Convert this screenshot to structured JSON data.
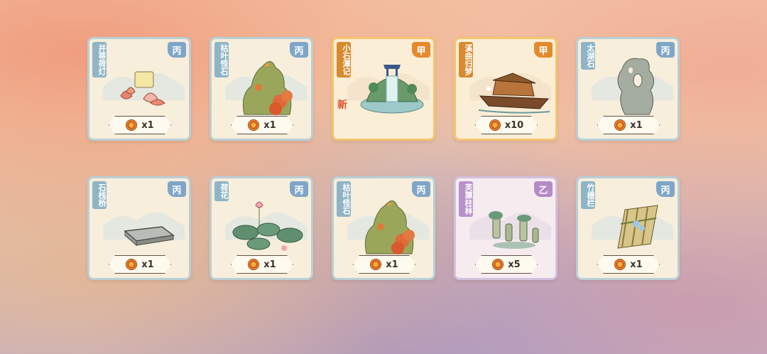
{
  "cards": [
    {
      "name": "并蒂荷灯",
      "grade": "丙",
      "qty": "x1",
      "rarity": "bing",
      "is_new": false,
      "art": "lotus-lamp"
    },
    {
      "name": "枯叶怪石",
      "grade": "丙",
      "qty": "x1",
      "rarity": "bing",
      "is_new": false,
      "art": "leaf-rock"
    },
    {
      "name": "小石潭记",
      "grade": "甲",
      "qty": "x1",
      "rarity": "jia",
      "is_new": true,
      "new_label": "新",
      "art": "waterfall"
    },
    {
      "name": "溪曲归梦",
      "grade": "甲",
      "qty": "x10",
      "rarity": "jia",
      "is_new": false,
      "art": "boat"
    },
    {
      "name": "太湖石",
      "grade": "丙",
      "qty": "x1",
      "rarity": "bing",
      "is_new": false,
      "art": "taihu-stone"
    },
    {
      "name": "石栈桥",
      "grade": "丙",
      "qty": "x1",
      "rarity": "bing",
      "is_new": false,
      "art": "stone-bridge"
    },
    {
      "name": "荷花",
      "grade": "丙",
      "qty": "x1",
      "rarity": "bing",
      "is_new": false,
      "art": "lotus-pads"
    },
    {
      "name": "枯叶怪石",
      "grade": "丙",
      "qty": "x1",
      "rarity": "bing",
      "is_new": false,
      "art": "leaf-rock"
    },
    {
      "name": "芙蕖柱林",
      "grade": "乙",
      "qty": "x5",
      "rarity": "yi",
      "is_new": false,
      "art": "pillars"
    },
    {
      "name": "竹栅栏",
      "grade": "丙",
      "qty": "x1",
      "rarity": "bing",
      "is_new": false,
      "art": "bamboo-fence"
    }
  ],
  "colors": {
    "bing": "#7fa6c8",
    "jia": "#e58a2c",
    "yi": "#b48ac8",
    "coin": "#f3b13c"
  },
  "icons": {
    "currency": "coin-icon"
  }
}
